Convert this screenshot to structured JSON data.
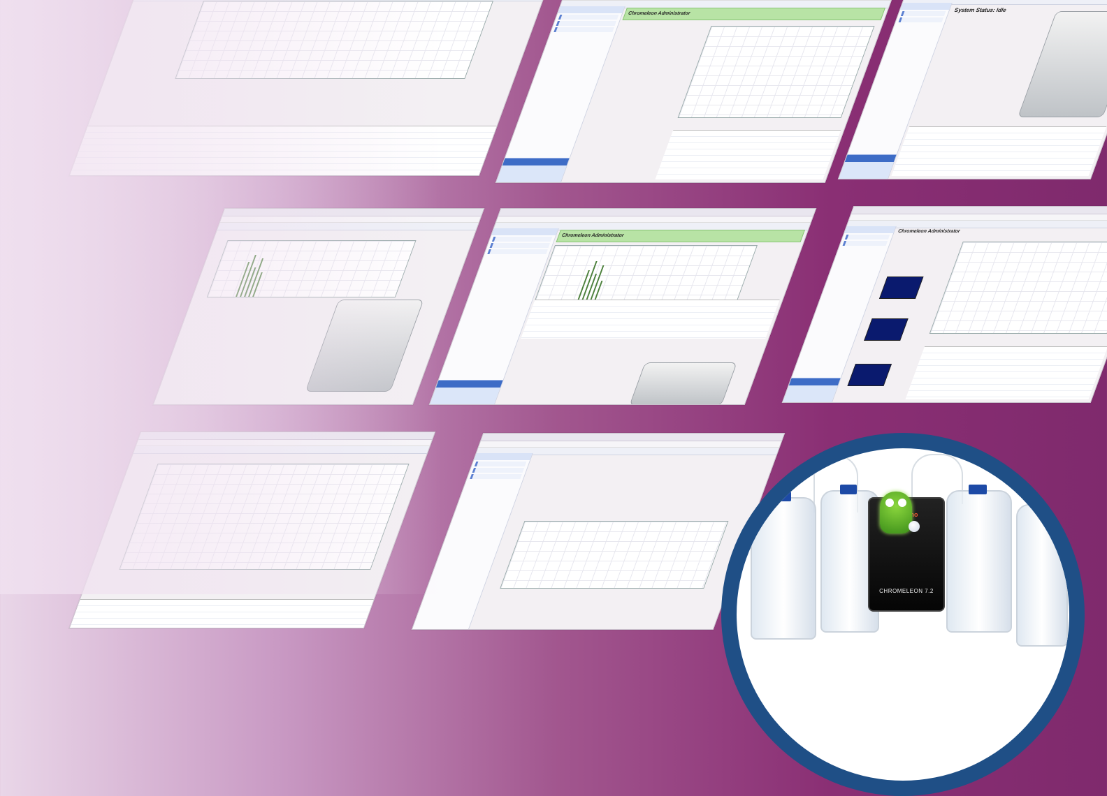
{
  "colors": {
    "background_left": "#e9d6e8",
    "background_right": "#7f2a6d",
    "badge_ring": "#1f4f86",
    "green_header": "#b8e3a5",
    "sidebar_blue": "#3d6cc6"
  },
  "screenshots": [
    {
      "id": "s1",
      "title": ""
    },
    {
      "id": "s2",
      "title": "Chromeleon Administrator"
    },
    {
      "id": "s3",
      "title": "System Status: Idle"
    },
    {
      "id": "s4",
      "title": ""
    },
    {
      "id": "s5",
      "title": "Chromeleon Administrator"
    },
    {
      "id": "s6",
      "title": "Chromeleon Administrator"
    },
    {
      "id": "s7",
      "title": ""
    },
    {
      "id": "s8",
      "title": ""
    }
  ],
  "badge": {
    "brand": "Thermo",
    "product": "CHROMELEON 7.2"
  },
  "icons": {
    "mascot": "green-alien-mascot-icon",
    "bottles": "solvent-bottle-icon"
  }
}
